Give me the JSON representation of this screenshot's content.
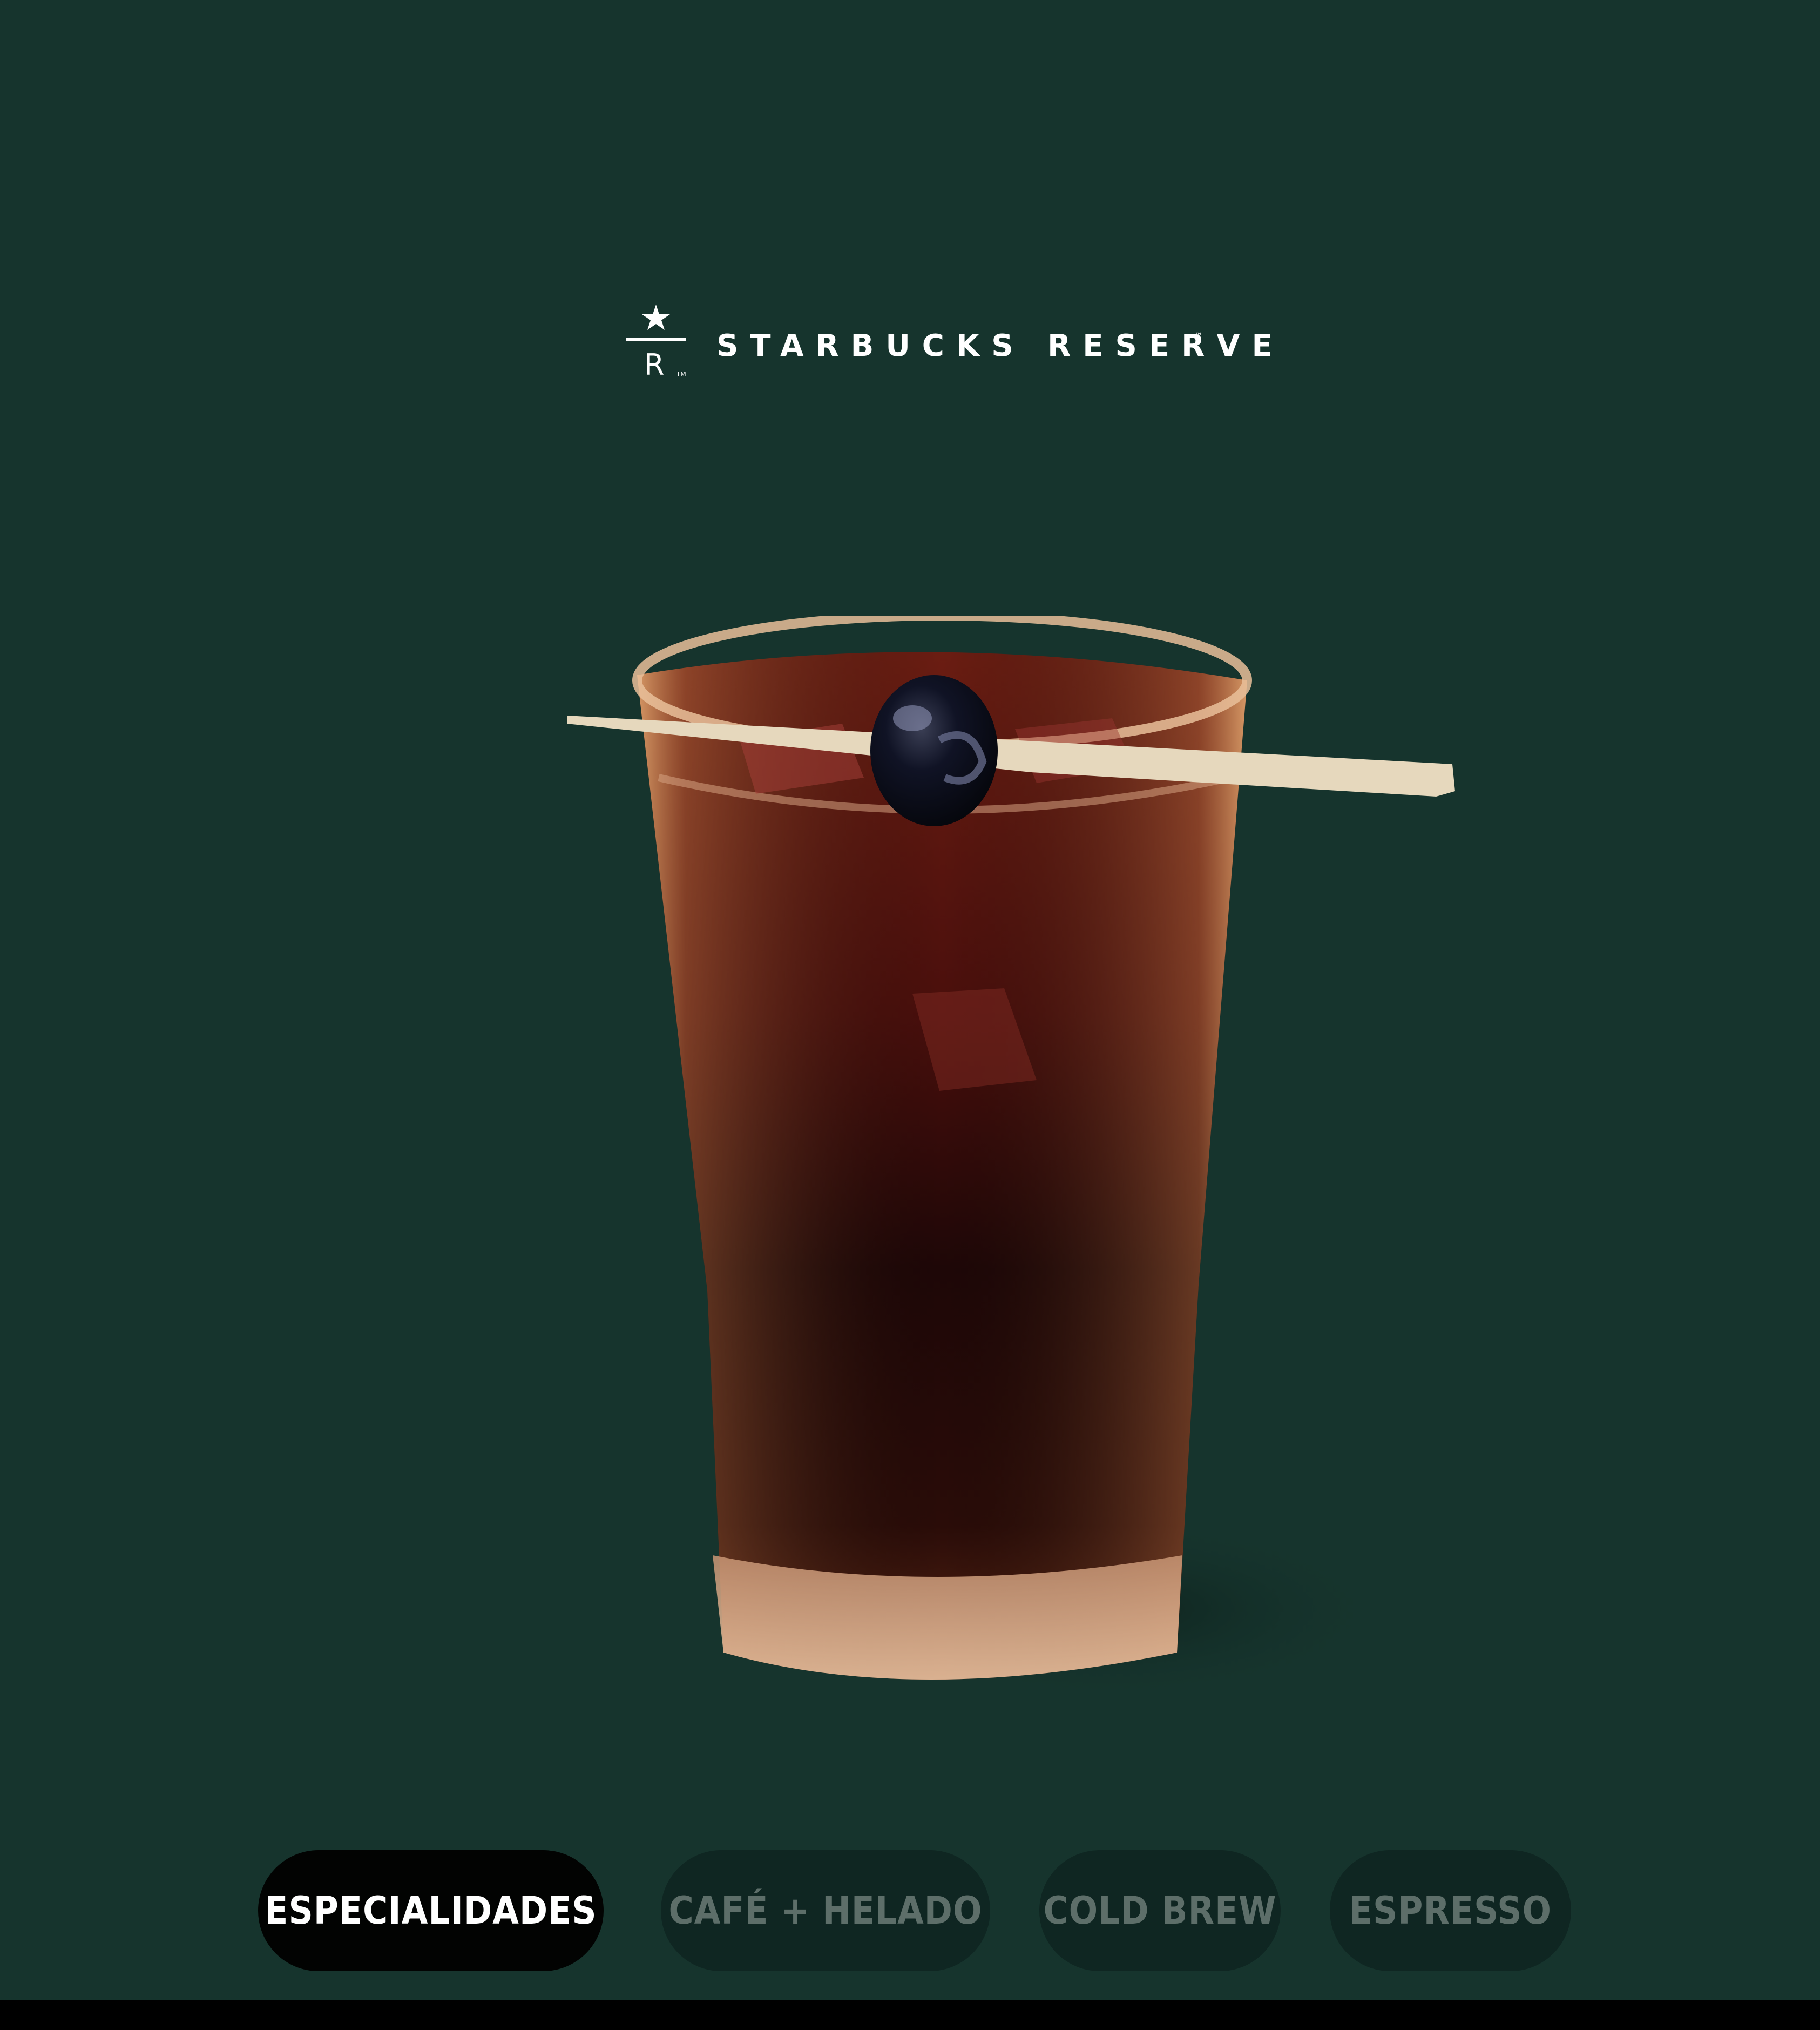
{
  "brand": {
    "name": "STARBUCKS RESERVE",
    "logo_letter": "R",
    "trademark": "™"
  },
  "product": {
    "icon": "iced-coffee-cherry-glass-image"
  },
  "categories": [
    {
      "label": "ESPECIALIDADES",
      "active": true
    },
    {
      "label": "CAFÉ + HELADO",
      "active": false
    },
    {
      "label": "COLD BREW",
      "active": false
    },
    {
      "label": "ESPRESSO",
      "active": false
    }
  ],
  "colors": {
    "background": "#16342d",
    "active_pill": "#020302",
    "inactive_pill": "#0f2622",
    "inactive_text": "#5d6e69"
  }
}
